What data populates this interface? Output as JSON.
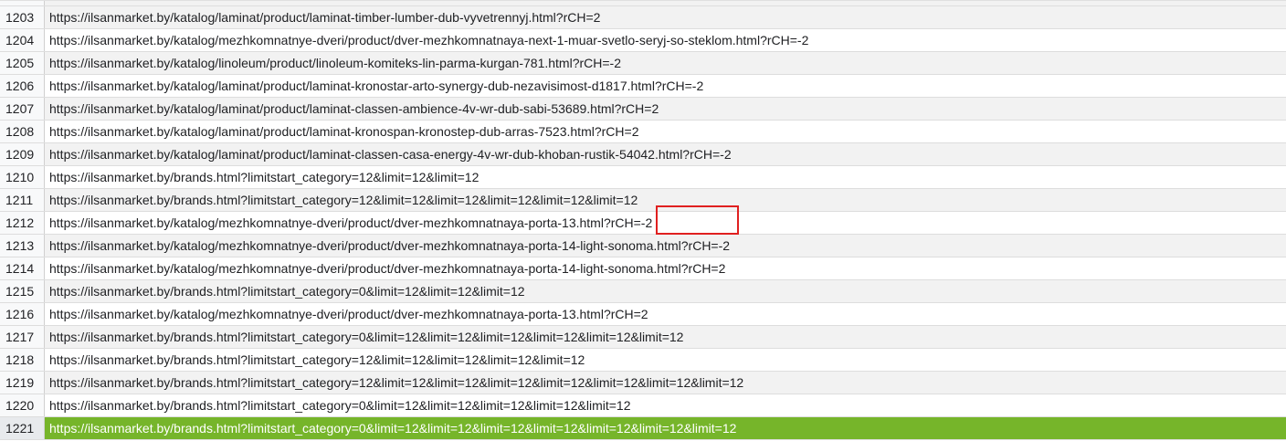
{
  "rows": [
    {
      "num": "1203",
      "url": "https://ilsanmarket.by/katalog/laminat/product/laminat-timber-lumber-dub-vyvetrennyj.html?rCH=2"
    },
    {
      "num": "1204",
      "url": "https://ilsanmarket.by/katalog/mezhkomnatnye-dveri/product/dver-mezhkomnatnaya-next-1-muar-svetlo-seryj-so-steklom.html?rCH=-2"
    },
    {
      "num": "1205",
      "url": "https://ilsanmarket.by/katalog/linoleum/product/linoleum-komiteks-lin-parma-kurgan-781.html?rCH=-2"
    },
    {
      "num": "1206",
      "url": "https://ilsanmarket.by/katalog/laminat/product/laminat-kronostar-arto-synergy-dub-nezavisimost-d1817.html?rCH=-2"
    },
    {
      "num": "1207",
      "url": "https://ilsanmarket.by/katalog/laminat/product/laminat-classen-ambience-4v-wr-dub-sabi-53689.html?rCH=2"
    },
    {
      "num": "1208",
      "url": "https://ilsanmarket.by/katalog/laminat/product/laminat-kronospan-kronostep-dub-arras-7523.html?rCH=2"
    },
    {
      "num": "1209",
      "url": "https://ilsanmarket.by/katalog/laminat/product/laminat-classen-casa-energy-4v-wr-dub-khoban-rustik-54042.html?rCH=-2"
    },
    {
      "num": "1210",
      "url": "https://ilsanmarket.by/brands.html?limitstart_category=12&limit=12&limit=12"
    },
    {
      "num": "1211",
      "url": "https://ilsanmarket.by/brands.html?limitstart_category=12&limit=12&limit=12&limit=12&limit=12&limit=12"
    },
    {
      "num": "1212",
      "url": "https://ilsanmarket.by/katalog/mezhkomnatnye-dveri/product/dver-mezhkomnatnaya-porta-13.html?rCH=-2"
    },
    {
      "num": "1213",
      "url": "https://ilsanmarket.by/katalog/mezhkomnatnye-dveri/product/dver-mezhkomnatnaya-porta-14-light-sonoma.html?rCH=-2"
    },
    {
      "num": "1214",
      "url": "https://ilsanmarket.by/katalog/mezhkomnatnye-dveri/product/dver-mezhkomnatnaya-porta-14-light-sonoma.html?rCH=2"
    },
    {
      "num": "1215",
      "url": "https://ilsanmarket.by/brands.html?limitstart_category=0&limit=12&limit=12&limit=12"
    },
    {
      "num": "1216",
      "url": "https://ilsanmarket.by/katalog/mezhkomnatnye-dveri/product/dver-mezhkomnatnaya-porta-13.html?rCH=2"
    },
    {
      "num": "1217",
      "url": "https://ilsanmarket.by/brands.html?limitstart_category=0&limit=12&limit=12&limit=12&limit=12&limit=12&limit=12"
    },
    {
      "num": "1218",
      "url": "https://ilsanmarket.by/brands.html?limitstart_category=12&limit=12&limit=12&limit=12&limit=12"
    },
    {
      "num": "1219",
      "url": "https://ilsanmarket.by/brands.html?limitstart_category=12&limit=12&limit=12&limit=12&limit=12&limit=12&limit=12&limit=12"
    },
    {
      "num": "1220",
      "url": "https://ilsanmarket.by/brands.html?limitstart_category=0&limit=12&limit=12&limit=12&limit=12&limit=12"
    },
    {
      "num": "1221",
      "url": "https://ilsanmarket.by/brands.html?limitstart_category=0&limit=12&limit=12&limit=12&limit=12&limit=12&limit=12&limit=12",
      "selected": true
    }
  ],
  "colors": {
    "selected_row": "#76b52a",
    "highlight_box": "#e02020"
  }
}
